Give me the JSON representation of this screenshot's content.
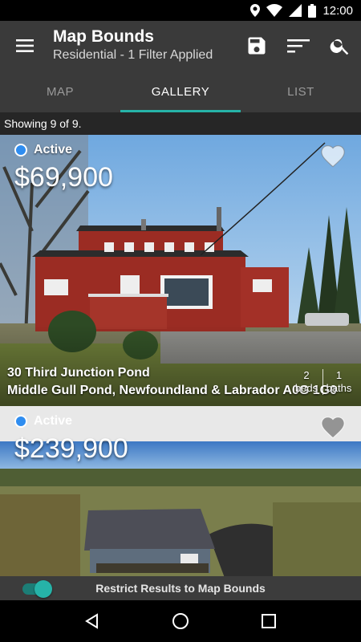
{
  "status_bar": {
    "time": "12:00"
  },
  "toolbar": {
    "title": "Map Bounds",
    "subtitle": "Residential - 1 Filter Applied",
    "menu_icon": "hamburger-menu-icon",
    "save_icon": "save-icon",
    "sort_icon": "sort-icon",
    "search_icon": "search-icon"
  },
  "tabs": [
    {
      "label": "MAP",
      "active": false
    },
    {
      "label": "GALLERY",
      "active": true
    },
    {
      "label": "LIST",
      "active": false
    }
  ],
  "result_count": "Showing 9 of 9.",
  "listings": [
    {
      "status": "Active",
      "price": "$69,900",
      "address_line1": "30 Third Junction Pond",
      "address_line2": "Middle Gull Pond, Newfoundland & Labrador A0G 1G0",
      "beds_value": "2",
      "beds_label": "beds",
      "baths_value": "1",
      "baths_label": "baths",
      "favorite": false
    },
    {
      "status": "Active",
      "price": "$239,900",
      "favorite": false
    }
  ],
  "restrict_bar": {
    "label": "Restrict Results to Map Bounds",
    "enabled": true
  },
  "colors": {
    "accent": "#26b3a8",
    "status_active": "#2f8df0",
    "toolbar_bg": "#3a3a3a"
  }
}
